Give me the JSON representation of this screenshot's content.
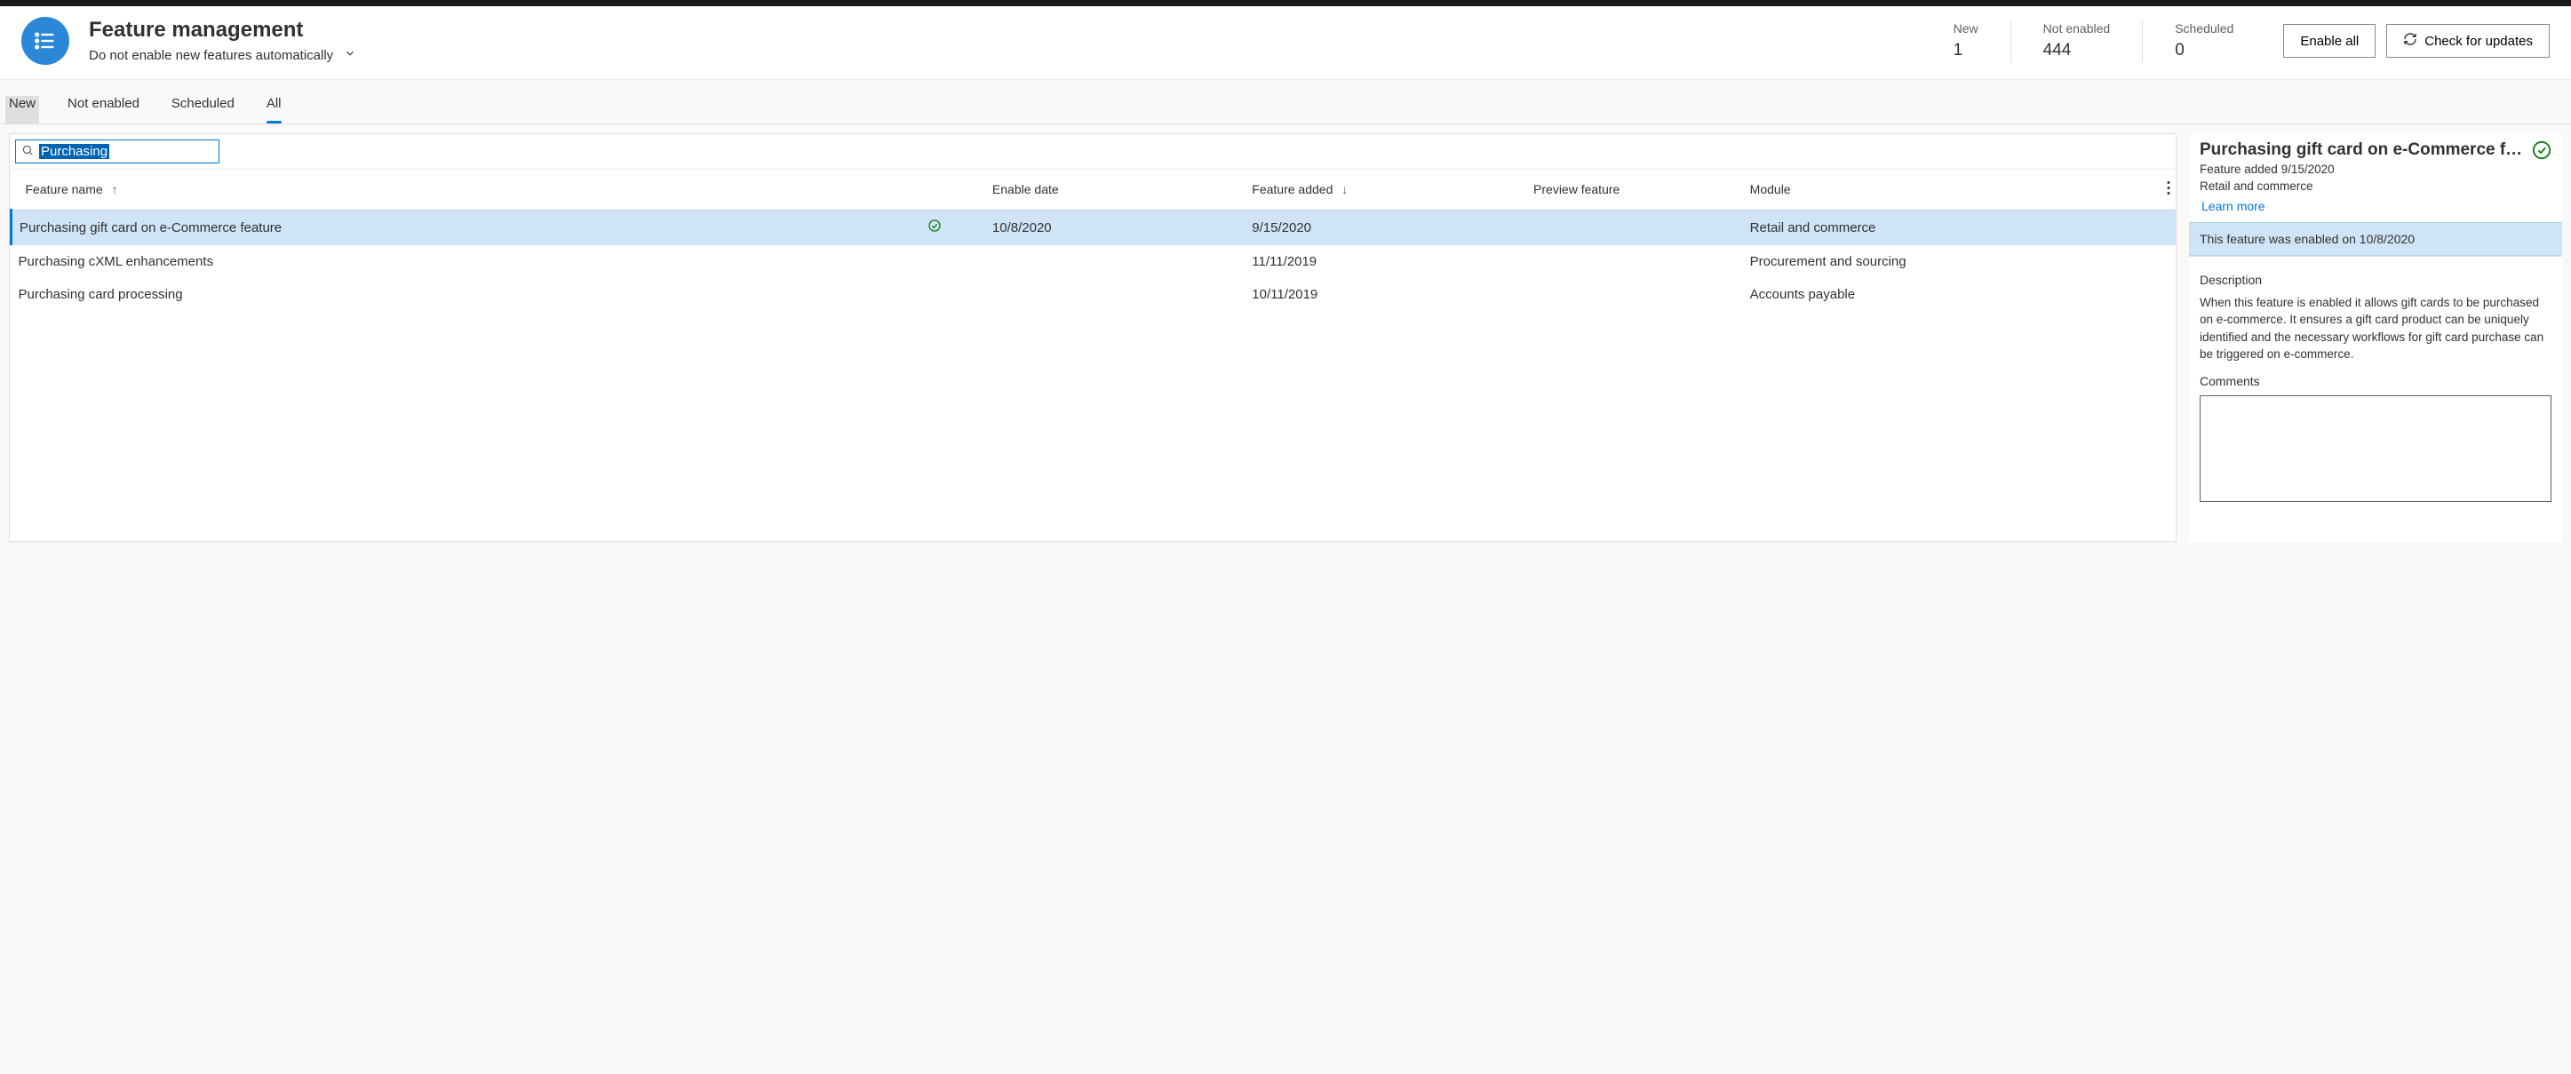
{
  "header": {
    "title": "Feature management",
    "subtitle": "Do not enable new features automatically",
    "stats": [
      {
        "label": "New",
        "value": "1"
      },
      {
        "label": "Not enabled",
        "value": "444"
      },
      {
        "label": "Scheduled",
        "value": "0"
      }
    ],
    "enable_all": "Enable all",
    "check_updates": "Check for updates"
  },
  "tabs": [
    "New",
    "Not enabled",
    "Scheduled",
    "All"
  ],
  "search": {
    "value": "Purchasing"
  },
  "columns": {
    "name": "Feature name",
    "enable_date": "Enable date",
    "added": "Feature added",
    "preview": "Preview feature",
    "module": "Module"
  },
  "rows": [
    {
      "name": "Purchasing gift card on e-Commerce feature",
      "enabled": true,
      "enable_date": "10/8/2020",
      "added": "9/15/2020",
      "preview": "",
      "module": "Retail and commerce"
    },
    {
      "name": "Purchasing cXML enhancements",
      "enabled": false,
      "enable_date": "",
      "added": "11/11/2019",
      "preview": "",
      "module": "Procurement and sourcing"
    },
    {
      "name": "Purchasing card processing",
      "enabled": false,
      "enable_date": "",
      "added": "10/11/2019",
      "preview": "",
      "module": "Accounts payable"
    }
  ],
  "detail": {
    "title": "Purchasing gift card on e-Commerce f…",
    "added_line": "Feature added 9/15/2020",
    "module_line": "Retail and commerce",
    "learn_more": "Learn more",
    "banner": "This feature was enabled on 10/8/2020",
    "description_label": "Description",
    "description": "When this feature is enabled it allows gift cards to be purchased on e-commerce. It ensures a gift card product can be uniquely identified and the necessary workflows for gift card purchase can be triggered on e-commerce.",
    "comments_label": "Comments",
    "comments_value": ""
  }
}
